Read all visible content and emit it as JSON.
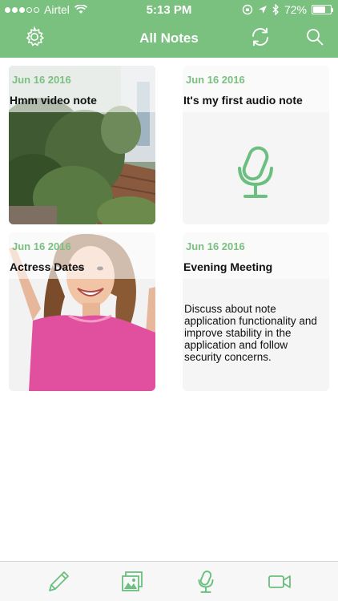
{
  "status_bar": {
    "carrier": "Airtel",
    "time": "5:13 PM",
    "battery": "72%",
    "battery_level": 0.72,
    "signal_bars_filled": 3,
    "signal_bars_total": 5
  },
  "nav": {
    "title": "All Notes",
    "left_icon": "settings-gear-icon",
    "right_icons": [
      "refresh-icon",
      "search-icon"
    ]
  },
  "notes": [
    {
      "type": "video",
      "date": "Jun 16 2016",
      "title": "Hmm video note",
      "thumbnail": "garden-photo"
    },
    {
      "type": "audio",
      "date": "Jun 16 2016",
      "title": "It's my first audio note",
      "icon": "microphone-icon"
    },
    {
      "type": "image",
      "date": "Jun 16 2016",
      "title": "Actress Dates",
      "thumbnail": "woman-photo"
    },
    {
      "type": "text",
      "date": "Jun 16 2016",
      "title": "Evening Meeting",
      "body": "Discuss about note application functionality and improve stability in the application and follow security concerns."
    }
  ],
  "tabbar": {
    "items": [
      "pencil-icon",
      "photos-icon",
      "microphone-icon",
      "video-camera-icon"
    ]
  },
  "colors": {
    "accent": "#7ac07f",
    "card_bg": "#f5f5f5",
    "tabbar_bg": "#f7f7f7",
    "shirt_pink": "#e0509e"
  }
}
